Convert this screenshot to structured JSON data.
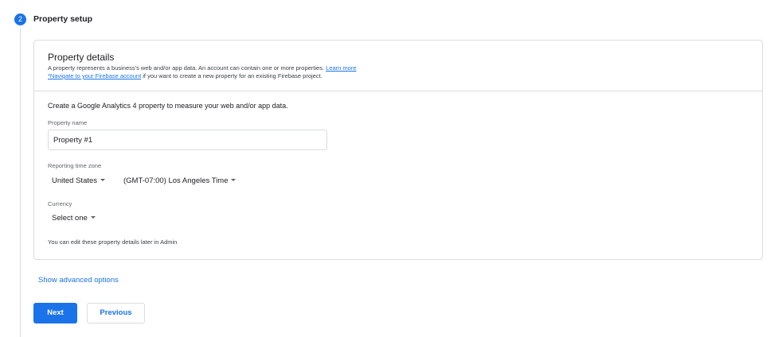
{
  "step": {
    "number": "2",
    "title": "Property setup"
  },
  "card": {
    "title": "Property details",
    "desc_line1": "A property represents a business's web and/or app data. An account can contain one or more properties.",
    "learn_more": "Learn more",
    "firebase_link": "*Navigate to your Firebase account",
    "desc_line2_rest": " if you want to create a new property for an existing Firebase project."
  },
  "form": {
    "lead": "Create a Google Analytics 4 property to measure your web and/or app data.",
    "property_name_label": "Property name",
    "property_name_value": "Property #1",
    "timezone_label": "Reporting time zone",
    "country_value": "United States",
    "timezone_value": "(GMT-07:00) Los Angeles Time",
    "currency_label": "Currency",
    "currency_value": "Select one",
    "note": "You can edit these property details later in Admin"
  },
  "actions": {
    "advanced": "Show advanced options",
    "next": "Next",
    "previous": "Previous"
  }
}
